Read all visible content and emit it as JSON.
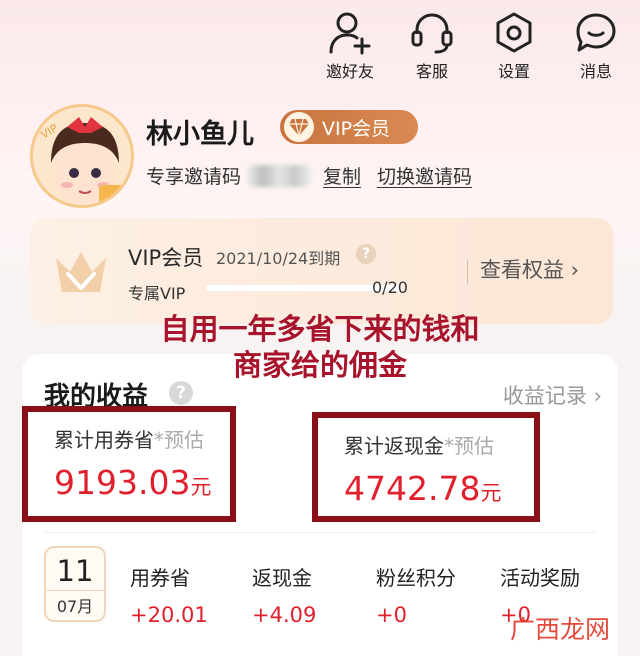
{
  "nav": [
    {
      "label": "邀好友",
      "icon": "add-user-icon"
    },
    {
      "label": "客服",
      "icon": "headset-icon"
    },
    {
      "label": "设置",
      "icon": "settings-hex-icon"
    },
    {
      "label": "消息",
      "icon": "chat-bubble-icon"
    }
  ],
  "profile": {
    "name": "林小鱼儿",
    "vip_badge": "VIP会员",
    "invite_label": "专享邀请码",
    "copy_label": "复制",
    "switch_label": "切换邀请码"
  },
  "vip_card": {
    "title": "VIP会员",
    "expiry": "2021/10/24到期",
    "help": "?",
    "sub_label": "专属VIP",
    "progress_text": "0/20",
    "progress_fraction": 0,
    "view_rights": "查看权益 ›"
  },
  "overlay": {
    "line1": "自用一年多省下来的钱和",
    "line2": "商家给的佣金"
  },
  "earnings": {
    "title": "我的收益",
    "help": "?",
    "record_link": "收益记录 ›",
    "coupon_saved": {
      "label": "累计用券省",
      "est": "*预估",
      "value": "9193.03",
      "unit": "元"
    },
    "cashback": {
      "label": "累计返现金",
      "est": "*预估",
      "value": "4742.78",
      "unit": "元"
    },
    "calendar": {
      "day": "11",
      "month": "07月"
    },
    "daily": [
      {
        "label": "用券省",
        "value": "+20.01"
      },
      {
        "label": "返现金",
        "value": "+4.09"
      },
      {
        "label": "粉丝积分",
        "value": "+0"
      },
      {
        "label": "活动奖励",
        "value": "+0"
      }
    ]
  },
  "watermark": "广西龙网",
  "colors": {
    "accent_red": "#e0202c",
    "highlight_border": "#8a0f16",
    "vip_brown": "#c9743e",
    "overlay_text": "#a8142b"
  }
}
